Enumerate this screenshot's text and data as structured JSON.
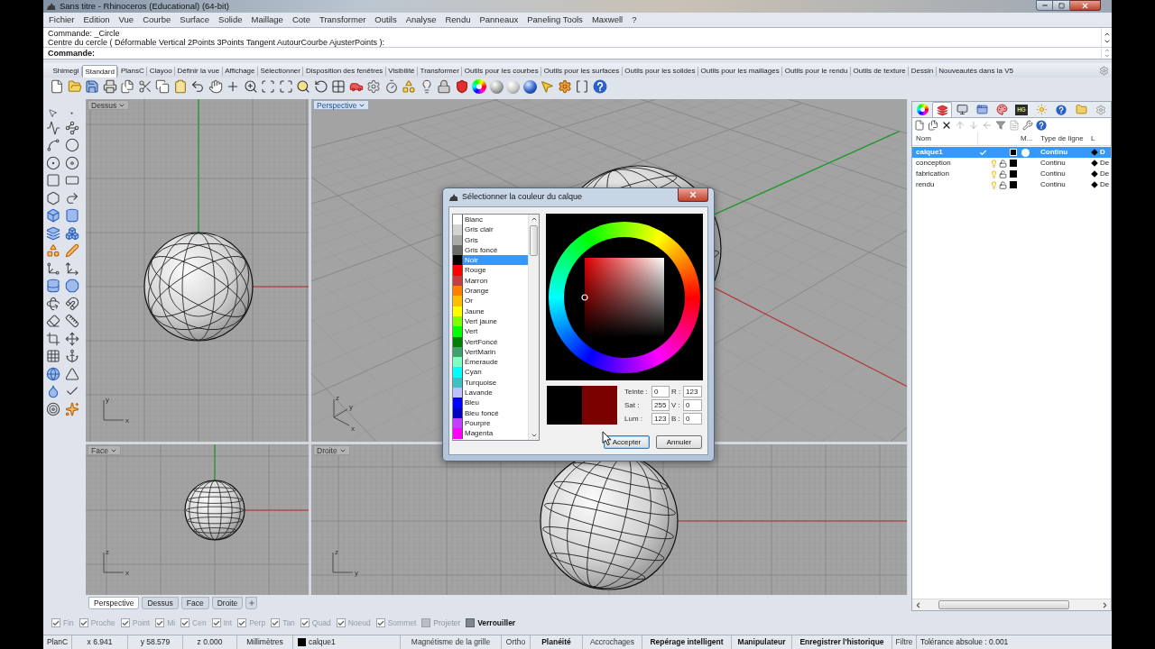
{
  "window": {
    "title": "Sans titre - Rhinoceros (Educational) (64-bit)"
  },
  "menu": [
    "Fichier",
    "Edition",
    "Vue",
    "Courbe",
    "Surface",
    "Solide",
    "Maillage",
    "Cote",
    "Transformer",
    "Outils",
    "Analyse",
    "Rendu",
    "Panneaux",
    "Paneling Tools",
    "Maxwell",
    "?"
  ],
  "command": {
    "history": [
      "Commande: _Circle",
      "Centre du cercle ( Déformable Vertical 2Points 3Points Tangent AutourCourbe AjusterPoints ):"
    ],
    "prompt": "Commande:"
  },
  "toolbar_tabs": [
    {
      "label": "Shimegi",
      "selected": false
    },
    {
      "label": "Standard",
      "selected": true
    },
    {
      "label": "PlansC",
      "selected": false
    },
    {
      "label": "Clayoo",
      "selected": false
    },
    {
      "label": "Définir la vue",
      "selected": false
    },
    {
      "label": "Affichage",
      "selected": false
    },
    {
      "label": "Sélectionner",
      "selected": false
    },
    {
      "label": "Disposition des fenêtres",
      "selected": false
    },
    {
      "label": "Visibilité",
      "selected": false
    },
    {
      "label": "Transformer",
      "selected": false
    },
    {
      "label": "Outils pour les courbes",
      "selected": false
    },
    {
      "label": "Outils pour les surfaces",
      "selected": false
    },
    {
      "label": "Outils pour les solides",
      "selected": false
    },
    {
      "label": "Outils pour les maillages",
      "selected": false
    },
    {
      "label": "Outils pour le rendu",
      "selected": false
    },
    {
      "label": "Outils de texture",
      "selected": false
    },
    {
      "label": "Dessin",
      "selected": false
    },
    {
      "label": "Nouveautés dans la V5",
      "selected": false
    }
  ],
  "viewports": [
    {
      "kind": "top",
      "title": "Dessus",
      "active": false,
      "axis_labels": [
        "y",
        "x"
      ]
    },
    {
      "kind": "perspective",
      "title": "Perspective",
      "active": true,
      "axis_labels": [
        "z",
        "y",
        "x"
      ]
    },
    {
      "kind": "front",
      "title": "Face",
      "active": false,
      "axis_labels": [
        "z",
        "x"
      ]
    },
    {
      "kind": "right",
      "title": "Droite",
      "active": false,
      "axis_labels": [
        "z",
        "y"
      ]
    }
  ],
  "layers": {
    "tabs": [
      {
        "selected": false
      },
      {
        "selected": true
      },
      {
        "selected": false
      },
      {
        "selected": false
      },
      {
        "selected": false
      },
      {
        "selected": false,
        "label": "HG"
      },
      {
        "selected": false
      },
      {
        "selected": false
      },
      {
        "selected": false
      },
      {
        "selected": false
      }
    ],
    "columns": [
      "Nom",
      "M...",
      "Type de ligne",
      "L"
    ],
    "rows": [
      {
        "name": "calque1",
        "selected": true,
        "current": true,
        "linetype": "Continu",
        "column_5": "D"
      },
      {
        "name": "conception",
        "selected": false,
        "current": false,
        "linetype": "Continu",
        "column_5": "De"
      },
      {
        "name": "fabrication",
        "selected": false,
        "current": false,
        "linetype": "Continu",
        "column_5": "De"
      },
      {
        "name": "rendu",
        "selected": false,
        "current": false,
        "linetype": "Continu",
        "column_5": "De"
      }
    ]
  },
  "dialog": {
    "title": "Sélectionner la couleur du calque",
    "colors": [
      {
        "name": "Blanc",
        "color": "#ffffff",
        "selected": false
      },
      {
        "name": "Gris clair",
        "color": "#d3d3d3",
        "selected": false
      },
      {
        "name": "Gris",
        "color": "#a9a9a9",
        "selected": false
      },
      {
        "name": "Gris foncé",
        "color": "#696969",
        "selected": false
      },
      {
        "name": "Noir",
        "color": "#000000",
        "selected": true
      },
      {
        "name": "Rouge",
        "color": "#ff0000",
        "selected": false
      },
      {
        "name": "Marron",
        "color": "#c04040",
        "selected": false
      },
      {
        "name": "Orange",
        "color": "#ff8000",
        "selected": false
      },
      {
        "name": "Or",
        "color": "#ffbf00",
        "selected": false
      },
      {
        "name": "Jaune",
        "color": "#ffff00",
        "selected": false
      },
      {
        "name": "Vert jaune",
        "color": "#80ff00",
        "selected": false
      },
      {
        "name": "Vert",
        "color": "#00ff00",
        "selected": false
      },
      {
        "name": "VertFoncé",
        "color": "#008000",
        "selected": false
      },
      {
        "name": "VertMarin",
        "color": "#40a070",
        "selected": false
      },
      {
        "name": "Émeraude",
        "color": "#80ffc0",
        "selected": false
      },
      {
        "name": "Cyan",
        "color": "#00ffff",
        "selected": false
      },
      {
        "name": "Turquoise",
        "color": "#40c0c0",
        "selected": false
      },
      {
        "name": "Lavande",
        "color": "#c0c0ff",
        "selected": false
      },
      {
        "name": "Bleu",
        "color": "#0000ff",
        "selected": false
      },
      {
        "name": "Bleu foncé",
        "color": "#0000c0",
        "selected": false
      },
      {
        "name": "Pourpre",
        "color": "#c040ff",
        "selected": false
      },
      {
        "name": "Magenta",
        "color": "#ff00ff",
        "selected": false
      }
    ],
    "preview": [
      {
        "color": "#000000"
      },
      {
        "color": "#7b0000"
      }
    ],
    "fields": [
      {
        "label": "Teinte :",
        "value": "0"
      },
      {
        "label": "R :",
        "value": "123"
      },
      {
        "label": "Sat :",
        "value": "255"
      },
      {
        "label": "V :",
        "value": "0"
      },
      {
        "label": "Lum :",
        "value": "123"
      },
      {
        "label": "B :",
        "value": "0"
      }
    ],
    "buttons": [
      {
        "label": "Accepter",
        "default": true
      },
      {
        "label": "Annuler",
        "default": false
      }
    ]
  },
  "viewport_tabs": [
    {
      "label": "Perspective",
      "selected": true
    },
    {
      "label": "Dessus",
      "selected": false
    },
    {
      "label": "Face",
      "selected": false
    },
    {
      "label": "Droite",
      "selected": false
    }
  ],
  "osnaps": [
    {
      "label": "Fin",
      "checked": true,
      "disabled": true
    },
    {
      "label": "Proche",
      "checked": true,
      "disabled": true
    },
    {
      "label": "Point",
      "checked": true,
      "disabled": true
    },
    {
      "label": "Mi",
      "checked": true,
      "disabled": true
    },
    {
      "label": "Cen",
      "checked": true,
      "disabled": true
    },
    {
      "label": "Int",
      "checked": true,
      "disabled": true
    },
    {
      "label": "Perp",
      "checked": true,
      "disabled": true
    },
    {
      "label": "Tan",
      "checked": true,
      "disabled": true
    },
    {
      "label": "Quad",
      "checked": true,
      "disabled": true
    },
    {
      "label": "Noeud",
      "checked": true,
      "disabled": true
    },
    {
      "label": "Sommet",
      "checked": true,
      "disabled": true
    }
  ],
  "osnap_toggles": [
    {
      "label": "Projeter",
      "on": false
    },
    {
      "label": "Verrouiller",
      "on": true
    }
  ],
  "status_bar": {
    "plane": "PlanC",
    "coords": [
      "x 6.941",
      "y 58.579",
      "z 0.000"
    ],
    "units": "Millimètres",
    "layer": "calque1",
    "toggles": [
      {
        "label": "Magnétisme de la grille",
        "on": false
      },
      {
        "label": "Ortho",
        "on": false
      },
      {
        "label": "Planéité",
        "on": true
      },
      {
        "label": "Accrochages",
        "on": false
      },
      {
        "label": "Repérage intelligent",
        "on": true
      },
      {
        "label": "Manipulateur",
        "on": true
      },
      {
        "label": "Enregistrer l'historique",
        "on": true
      },
      {
        "label": "Filtre",
        "on": false
      }
    ],
    "tolerance": "Tolérance absolue : 0.001"
  }
}
